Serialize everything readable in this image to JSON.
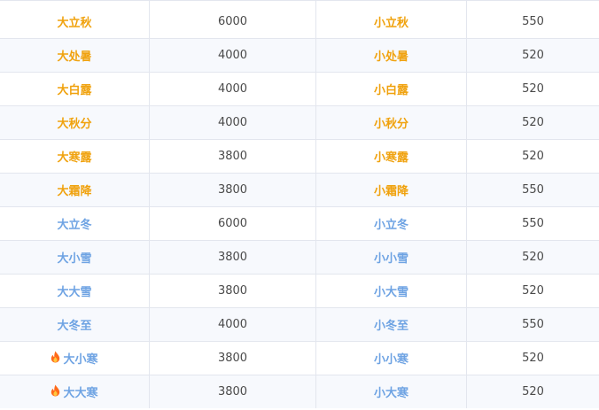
{
  "colors": {
    "autumn": "#f0a20e",
    "winter": "#6ea3e3",
    "fire": "#ff6a1a"
  },
  "rows": [
    {
      "big": "大立秋",
      "big_value": "6000",
      "small": "小立秋",
      "small_value": "550",
      "tone": "gold",
      "hot": false
    },
    {
      "big": "大处暑",
      "big_value": "4000",
      "small": "小处暑",
      "small_value": "520",
      "tone": "gold",
      "hot": false
    },
    {
      "big": "大白露",
      "big_value": "4000",
      "small": "小白露",
      "small_value": "520",
      "tone": "gold",
      "hot": false
    },
    {
      "big": "大秋分",
      "big_value": "4000",
      "small": "小秋分",
      "small_value": "520",
      "tone": "gold",
      "hot": false
    },
    {
      "big": "大寒露",
      "big_value": "3800",
      "small": "小寒露",
      "small_value": "520",
      "tone": "gold",
      "hot": false
    },
    {
      "big": "大霜降",
      "big_value": "3800",
      "small": "小霜降",
      "small_value": "550",
      "tone": "gold",
      "hot": false
    },
    {
      "big": "大立冬",
      "big_value": "6000",
      "small": "小立冬",
      "small_value": "550",
      "tone": "blue",
      "hot": false
    },
    {
      "big": "大小雪",
      "big_value": "3800",
      "small": "小小雪",
      "small_value": "520",
      "tone": "blue",
      "hot": false
    },
    {
      "big": "大大雪",
      "big_value": "3800",
      "small": "小大雪",
      "small_value": "520",
      "tone": "blue",
      "hot": false
    },
    {
      "big": "大冬至",
      "big_value": "4000",
      "small": "小冬至",
      "small_value": "550",
      "tone": "blue",
      "hot": false
    },
    {
      "big": "大小寒",
      "big_value": "3800",
      "small": "小小寒",
      "small_value": "520",
      "tone": "blue",
      "hot": true,
      "icon": "fire-icon"
    },
    {
      "big": "大大寒",
      "big_value": "3800",
      "small": "小大寒",
      "small_value": "520",
      "tone": "blue",
      "hot": true,
      "icon": "fire-icon"
    }
  ]
}
